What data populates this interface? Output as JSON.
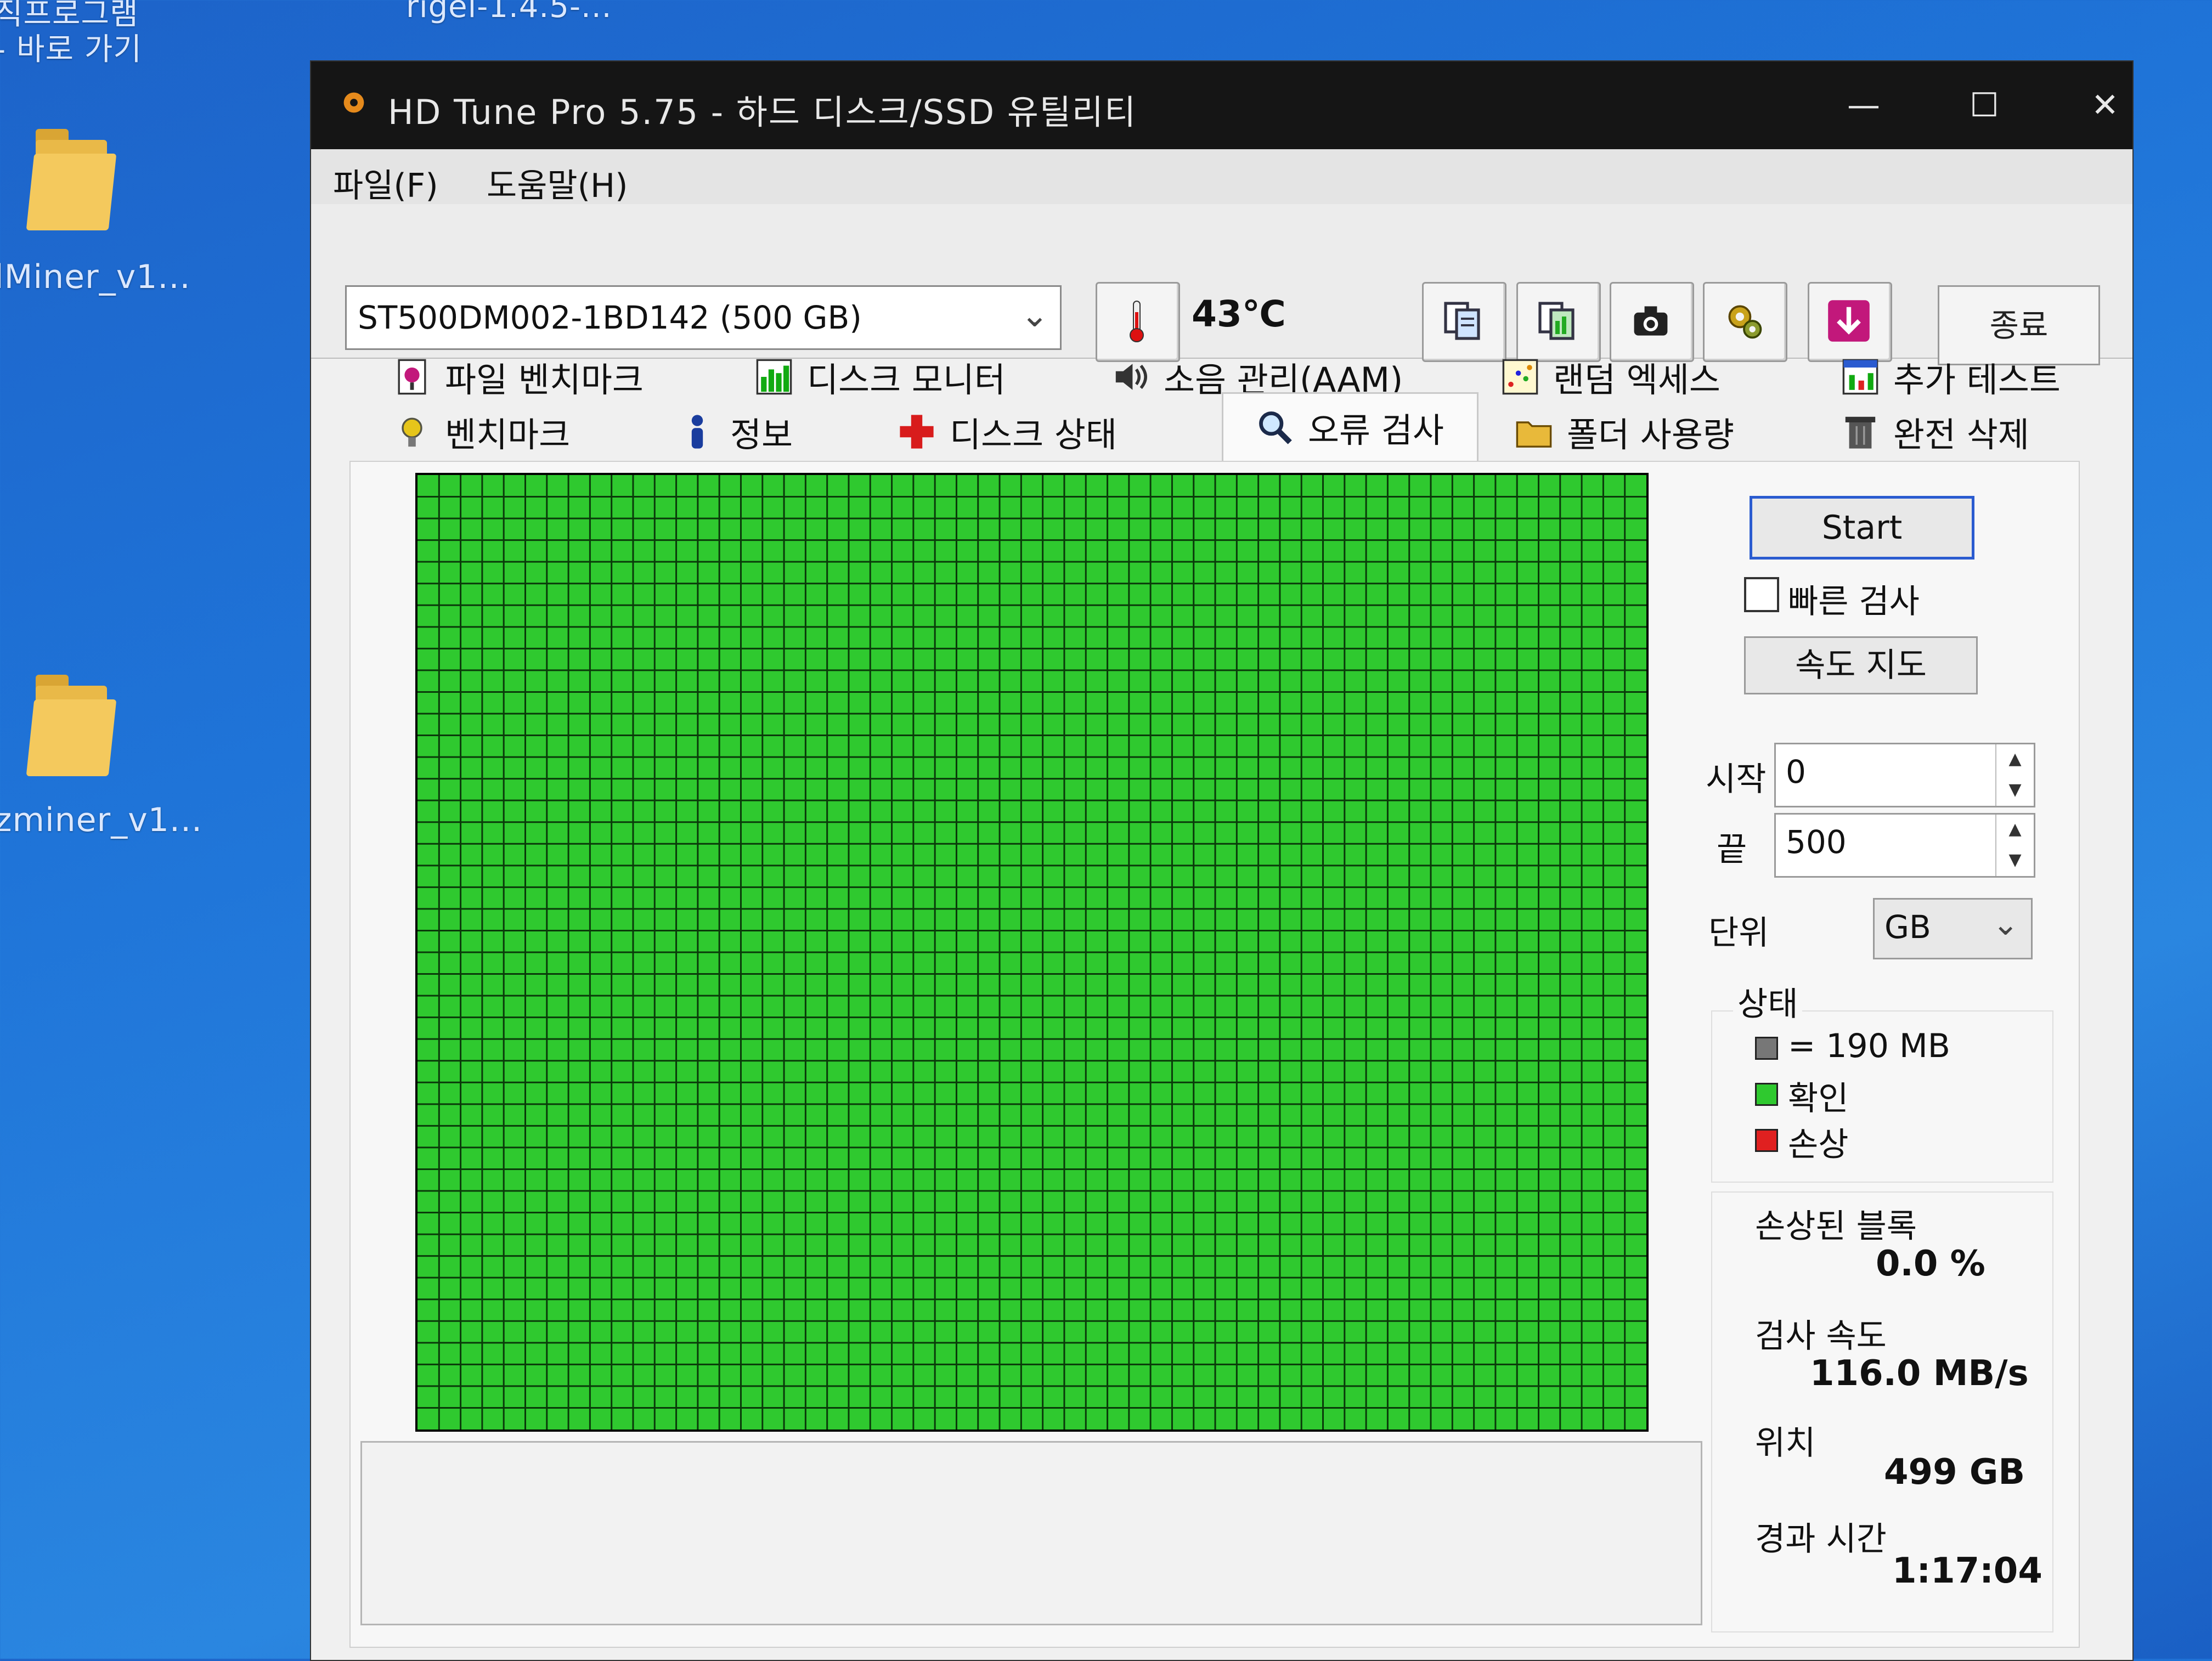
{
  "desktop": {
    "top_label_left": "직프로그램",
    "shortcut_label": "- 바로 가기",
    "top_label_right": "rigel-1.4.5-...",
    "icon1_label": "lMiner_v1...",
    "icon2_label": "zminer_v1..."
  },
  "window": {
    "title": "HD Tune Pro 5.75 - 하드 디스크/SSD 유틸리티",
    "controls": {
      "minimize": "—",
      "maximize": "☐",
      "close": "✕"
    }
  },
  "menu": {
    "file": "파일(F)",
    "help": "도움말(H)"
  },
  "toolbar": {
    "drive": "ST500DM002-1BD142 (500 GB)",
    "temperature": "43℃",
    "exit": "종료",
    "icons": [
      "copy-info-icon",
      "copy-screenshot-icon",
      "camera-icon",
      "options-icon",
      "save-download-icon"
    ]
  },
  "tabs": {
    "row1": [
      "파일 벤치마크",
      "디스크 모니터",
      "소음 관리(AAM)",
      "랜덤 엑세스",
      "추가 테스트"
    ],
    "row2": [
      "벤치마크",
      "정보",
      "디스크 상태",
      "오류 검사",
      "폴더 사용량",
      "완전 삭제"
    ],
    "active": "오류 검사"
  },
  "error_scan": {
    "start_button": "Start",
    "quick_scan_label": "빠른 검사",
    "quick_scan_checked": false,
    "speed_map_button": "속도 지도",
    "start_label": "시작",
    "start_value": "0",
    "end_label": "끝",
    "end_value": "500",
    "unit_label": "단위",
    "unit_value": "GB",
    "status": {
      "title": "상태",
      "block_size": "= 190 MB",
      "ok_label": "확인",
      "damaged_label": "손상"
    },
    "damaged_blocks_label": "손상된 블록",
    "damaged_blocks_value": "0.0 %",
    "speed_label": "검사 속도",
    "speed_value": "116.0 MB/s",
    "position_label": "위치",
    "position_value": "499 GB",
    "elapsed_label": "경과 시간",
    "elapsed_value": "1:17:04",
    "colors": {
      "ok": "#2fc92f",
      "damaged": "#e02020",
      "unscanned": "#777777",
      "grid_line": "#0a3a0a"
    },
    "grid": {
      "ok_fraction": 1.0
    }
  }
}
